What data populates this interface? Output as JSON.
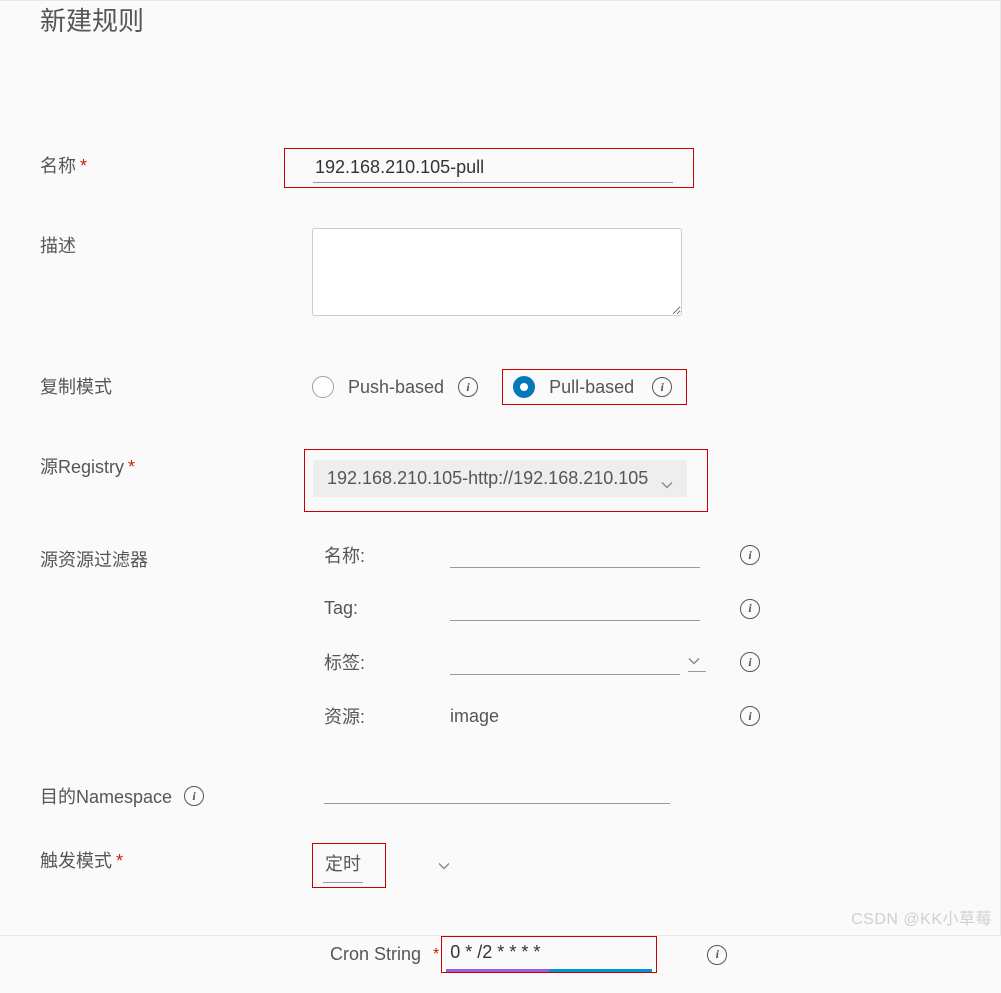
{
  "title": "新建规则",
  "name": {
    "label": "名称",
    "value": "192.168.210.105-pull"
  },
  "description": {
    "label": "描述",
    "value": ""
  },
  "replicationMode": {
    "label": "复制模式",
    "pushLabel": "Push-based",
    "pullLabel": "Pull-based",
    "selected": "pull"
  },
  "sourceRegistry": {
    "label": "源Registry",
    "value": "192.168.210.105-http://192.168.210.105"
  },
  "sourceFilter": {
    "label": "源资源过滤器",
    "nameLabel": "名称:",
    "nameValue": "",
    "tagLabel": "Tag:",
    "tagValue": "",
    "labelLabel": "标签:",
    "labelValue": "",
    "resourceLabel": "资源:",
    "resourceValue": "image"
  },
  "destNamespace": {
    "label": "目的Namespace",
    "value": ""
  },
  "trigger": {
    "label": "触发模式",
    "value": "定时",
    "cronLabel": "Cron String",
    "cronValue": "0 * /2 * * * *"
  },
  "watermark": "CSDN @KK小草莓"
}
